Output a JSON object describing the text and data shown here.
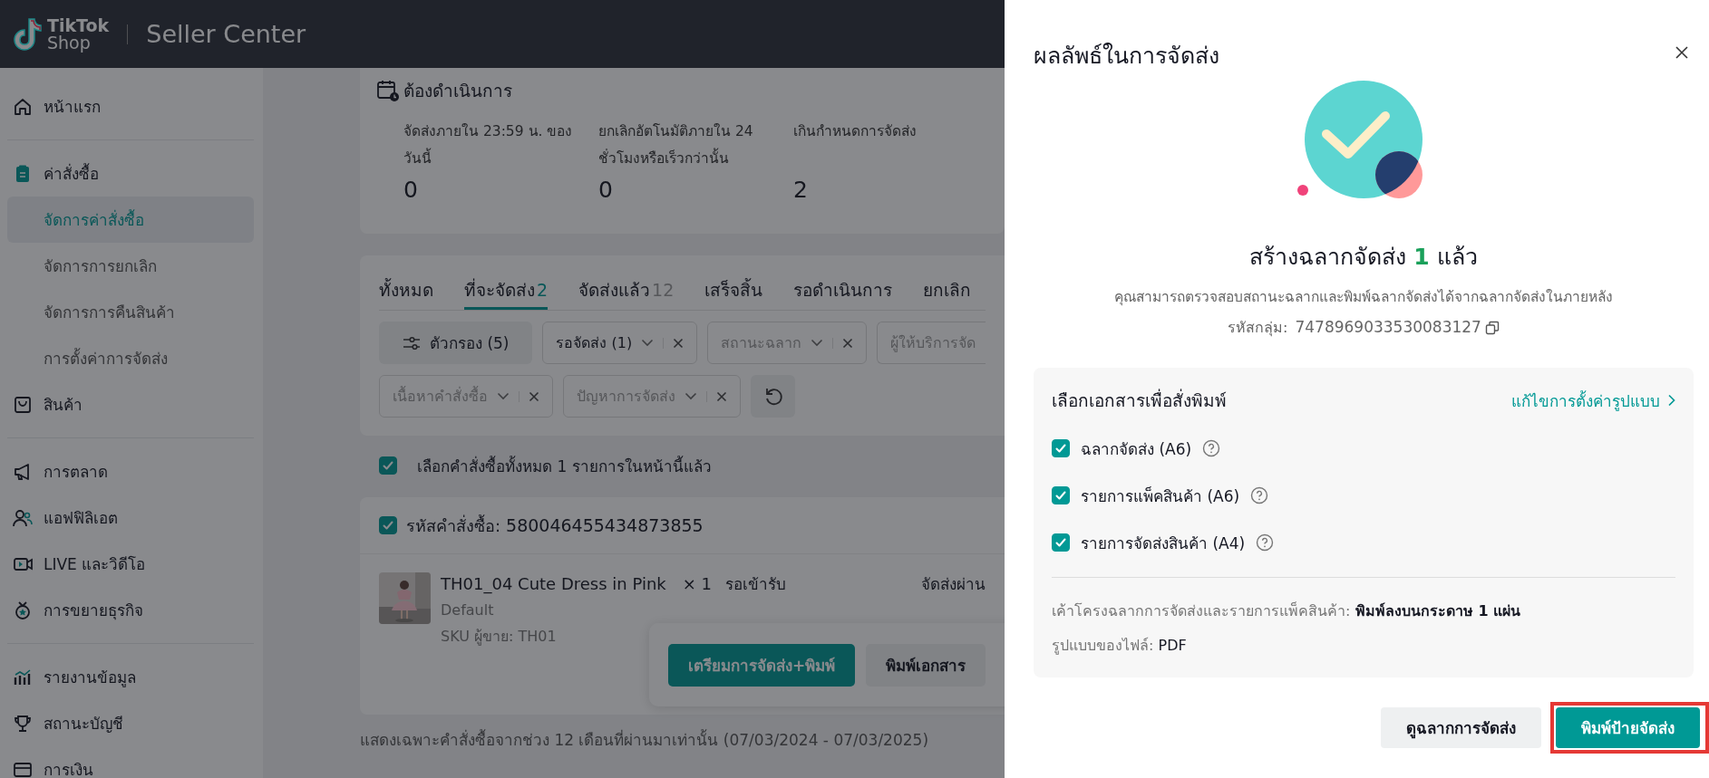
{
  "header": {
    "logo_top": "TikTok",
    "logo_bottom": "Shop",
    "title": "Seller Center"
  },
  "sidebar": {
    "sections": [
      {
        "items": [
          {
            "label": "หน้าแรก",
            "selected": false
          }
        ]
      },
      {
        "items": [
          {
            "label": "ค่าสั่งซื้อ",
            "selected": false,
            "children": [
              {
                "label": "จัดการค่าสั่งซื้อ",
                "selected": true
              },
              {
                "label": "จัดการการยกเลิก",
                "selected": false
              },
              {
                "label": "จัดการการคืนสินค้า",
                "selected": false
              },
              {
                "label": "การตั้งค่าการจัดส่ง",
                "selected": false
              }
            ]
          },
          {
            "label": "สินค้า",
            "selected": false
          }
        ]
      },
      {
        "items": [
          {
            "label": "การตลาด",
            "selected": false
          },
          {
            "label": "แอฟฟิลิเอต",
            "selected": false
          },
          {
            "label": "LIVE และวิดีโอ",
            "selected": false
          },
          {
            "label": "การขยายธุรกิจ",
            "selected": false
          }
        ]
      },
      {
        "items": [
          {
            "label": "รายงานข้อมูล",
            "selected": false
          },
          {
            "label": "สถานะบัญชี",
            "selected": false
          },
          {
            "label": "การเงิน",
            "selected": false
          }
        ]
      }
    ]
  },
  "todo": {
    "title": "ต้องดำเนินการ",
    "metrics": [
      {
        "label": "จัดส่งภายใน 23:59 น. ของวันนี้",
        "value": "0"
      },
      {
        "label": "ยกเลิกอัตโนมัติภายใน 24 ชั่วโมงหรือเร็วกว่านั้น",
        "value": "0"
      },
      {
        "label": "เกินกำหนดการจัดส่ง",
        "value": "2"
      }
    ]
  },
  "tabs": [
    {
      "label": "ทั้งหมด",
      "selected": false
    },
    {
      "label": "ที่จะจัดส่ง",
      "count": "2",
      "selected": true
    },
    {
      "label": "จัดส่งแล้ว",
      "count": "12",
      "selected": false
    },
    {
      "label": "เสร็จสิ้น",
      "selected": false
    },
    {
      "label": "รอดำเนินการ",
      "selected": false
    },
    {
      "label": "ยกเลิก",
      "selected": false
    }
  ],
  "filter_rows": [
    [
      {
        "kind": "button",
        "label": "ตัวกรอง (5)"
      },
      {
        "kind": "select",
        "value": "รอจัดส่ง (1)"
      },
      {
        "kind": "select",
        "placeholder": "สถานะฉลาก"
      },
      {
        "kind": "select",
        "placeholder": "ผู้ให้บริการจัด"
      }
    ],
    [
      {
        "kind": "select",
        "placeholder": "เนื้อหาคำสั่งซื้อ"
      },
      {
        "kind": "select",
        "placeholder": "ปัญหาการจัดส่ง"
      },
      {
        "kind": "reset"
      }
    ]
  ],
  "select_all": {
    "checked": true,
    "label": "เลือกคำสั่งซื้อทั้งหมด 1 รายการในหน้านี้แล้ว"
  },
  "order": {
    "checked": true,
    "id_label": "รหัสคำสั่งซื้อ:",
    "id": "580046455434873855",
    "product": {
      "name": "TH01_04 Cute Dress in Pink",
      "quantity": "× 1",
      "variant": "Default",
      "sku": "SKU ผู้ขาย: TH01"
    },
    "status": "รอเข้ารับ",
    "shipping": "จัดส่งผ่าน"
  },
  "action_bar": {
    "buttons": [
      {
        "label": "เตรียมการจัดส่ง+พิมพ์",
        "kind": "primary"
      },
      {
        "label": "พิมพ์เอกสาร",
        "kind": "secondary"
      }
    ]
  },
  "footnote": "แสดงเฉพาะคำสั่งซื้อจากช่วง 12 เดือนที่ผ่านมาเท่านั้น (07/03/2024 - 07/03/2025)",
  "drawer": {
    "title": "ผลลัพธ์ในการจัดส่ง",
    "headline_before": "สร้างฉลากจัดส่ง",
    "count": "1",
    "headline_after": "แล้ว",
    "description": "คุณสามารถตรวจสอบสถานะฉลากและพิมพ์ฉลากจัดส่งได้จากฉลากจัดส่งในภายหลัง",
    "group_id_label": "รหัสกลุ่ม:",
    "group_id": "7478969033530083127",
    "print_panel": {
      "title": "เลือกเอกสารเพื่อสั่งพิมพ์",
      "edit_link": "แก้ไขการตั้งค่ารูปแบบ",
      "documents": [
        {
          "label": "ฉลากจัดส่ง (A6)",
          "checked": true
        },
        {
          "label": "รายการแพ็คสินค้า (A6)",
          "checked": true
        },
        {
          "label": "รายการจัดส่งสินค้า (A4)",
          "checked": true
        }
      ],
      "info": [
        {
          "label": "เค้าโครงฉลากการจัดส่งและรายการแพ็คสินค้า:",
          "value": "พิมพ์ลงบนกระดาษ 1 แผ่น",
          "strong": true
        },
        {
          "label": "รูปแบบของไฟล์:",
          "value": "PDF",
          "strong": false
        }
      ]
    },
    "buttons": [
      {
        "label": "ดูฉลากการจัดส่ง",
        "kind": "secondary",
        "highlighted": false
      },
      {
        "label": "พิมพ์ป้ายจัดส่ง",
        "kind": "primary",
        "highlighted": true
      }
    ]
  }
}
